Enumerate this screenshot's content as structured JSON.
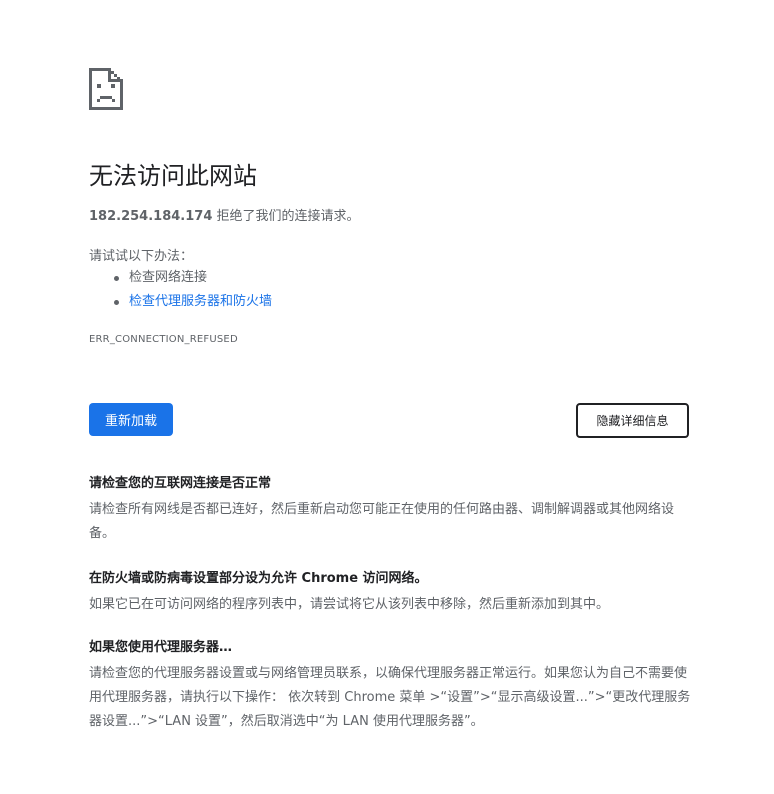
{
  "error": {
    "title": "无法访问此网站",
    "host": "182.254.184.174",
    "message": " 拒绝了我们的连接请求。",
    "try_label": "请试试以下办法：",
    "suggestions": {
      "check_connection": "检查网络连接",
      "check_proxy_firewall": "检查代理服务器和防火墙"
    },
    "code": "ERR_CONNECTION_REFUSED"
  },
  "buttons": {
    "reload": "重新加载",
    "hide_details": "隐藏详细信息"
  },
  "details": {
    "internet": {
      "heading": "请检查您的互联网连接是否正常",
      "body": "请检查所有网线是否都已连好，然后重新启动您可能正在使用的任何路由器、调制解调器或其他网络设备。"
    },
    "firewall": {
      "heading": "在防火墙或防病毒设置部分设为允许 Chrome 访问网络。",
      "body": "如果它已在可访问网络的程序列表中，请尝试将它从该列表中移除，然后重新添加到其中。"
    },
    "proxy": {
      "heading": "如果您使用代理服务器…",
      "body": "请检查您的代理服务器设置或与网络管理员联系，以确保代理服务器正常运行。如果您认为自己不需要使用代理服务器，请执行以下操作： 依次转到 Chrome 菜单 >“设置”>“显示高级设置...”>“更改代理服务器设置...”>“LAN 设置”，然后取消选中“为 LAN 使用代理服务器”。"
    }
  },
  "colors": {
    "accent": "#1a73e8",
    "text_primary": "#202124",
    "text_secondary": "#5f6368"
  },
  "icons": {
    "main": "sad-page-icon"
  }
}
